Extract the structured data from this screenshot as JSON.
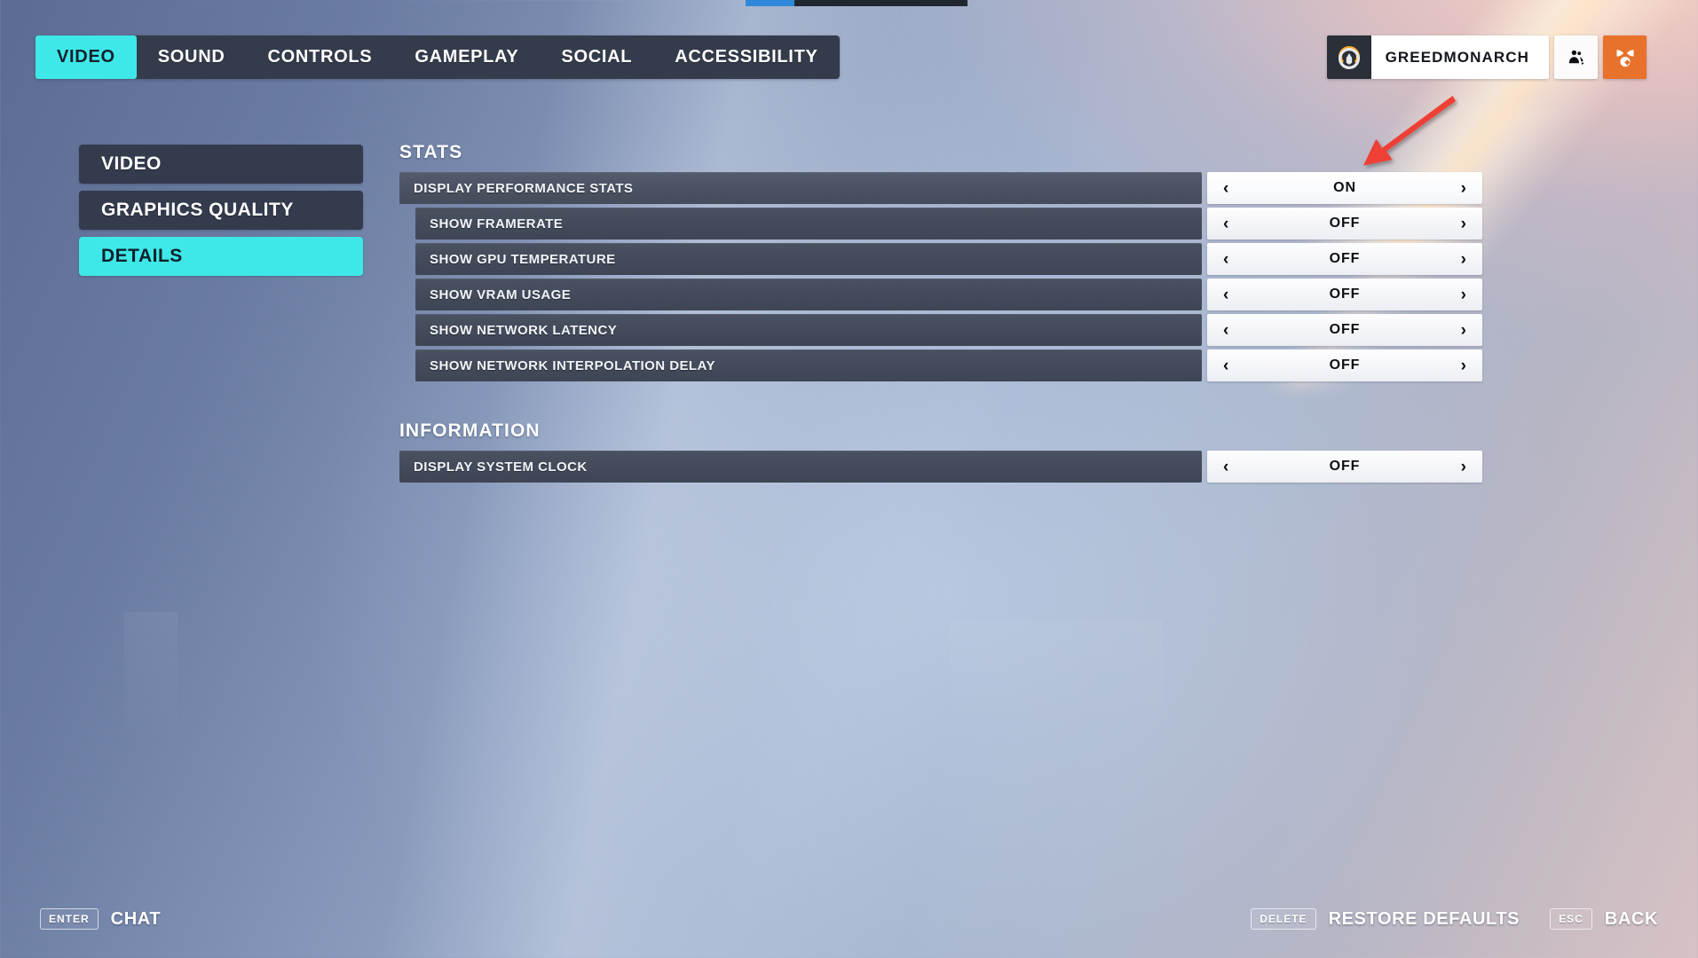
{
  "top_progress": {
    "percent": 22
  },
  "nav": {
    "tabs": [
      {
        "label": "VIDEO",
        "active": true
      },
      {
        "label": "SOUND",
        "active": false
      },
      {
        "label": "CONTROLS",
        "active": false
      },
      {
        "label": "GAMEPLAY",
        "active": false
      },
      {
        "label": "SOCIAL",
        "active": false
      },
      {
        "label": "ACCESSIBILITY",
        "active": false
      }
    ]
  },
  "profile": {
    "logo_icon": "overwatch-logo-icon",
    "player_name": "GREEDMONARCH",
    "buttons": [
      {
        "icon": "group-people-icon",
        "style": "white"
      },
      {
        "icon": "medal-badge-icon",
        "style": "orange"
      }
    ]
  },
  "sidebar": {
    "items": [
      {
        "label": "VIDEO",
        "active": false
      },
      {
        "label": "GRAPHICS QUALITY",
        "active": false
      },
      {
        "label": "DETAILS",
        "active": true
      }
    ]
  },
  "settings": {
    "sections": [
      {
        "title": "STATS",
        "rows": [
          {
            "label": "DISPLAY PERFORMANCE STATS",
            "value": "ON",
            "indent": 0,
            "highlight": true
          },
          {
            "label": "SHOW FRAMERATE",
            "value": "OFF",
            "indent": 1,
            "highlight": false
          },
          {
            "label": "SHOW GPU TEMPERATURE",
            "value": "OFF",
            "indent": 1,
            "highlight": false
          },
          {
            "label": "SHOW VRAM USAGE",
            "value": "OFF",
            "indent": 1,
            "highlight": false
          },
          {
            "label": "SHOW NETWORK LATENCY",
            "value": "OFF",
            "indent": 1,
            "highlight": false
          },
          {
            "label": "SHOW NETWORK INTERPOLATION DELAY",
            "value": "OFF",
            "indent": 1,
            "highlight": false
          }
        ]
      },
      {
        "title": "INFORMATION",
        "rows": [
          {
            "label": "DISPLAY SYSTEM CLOCK",
            "value": "OFF",
            "indent": 0,
            "highlight": false
          }
        ]
      }
    ],
    "selector": {
      "left_arrow": "‹",
      "right_arrow": "›"
    }
  },
  "annotation": {
    "type": "red-arrow",
    "color": "#ee4036",
    "points_to": "DISPLAY PERFORMANCE STATS selector"
  },
  "footer": {
    "left": [
      {
        "key": "ENTER",
        "label": "CHAT"
      }
    ],
    "right": [
      {
        "key": "DELETE",
        "label": "RESTORE DEFAULTS"
      },
      {
        "key": "ESC",
        "label": "BACK"
      }
    ]
  },
  "colors": {
    "accent_cyan": "#3ee8e8",
    "panel_dark": "#343c4c",
    "row_dark": "#464e5e",
    "selector_light": "#f6f7fa",
    "orange": "#e8712b",
    "progress_blue": "#2e87d8"
  }
}
